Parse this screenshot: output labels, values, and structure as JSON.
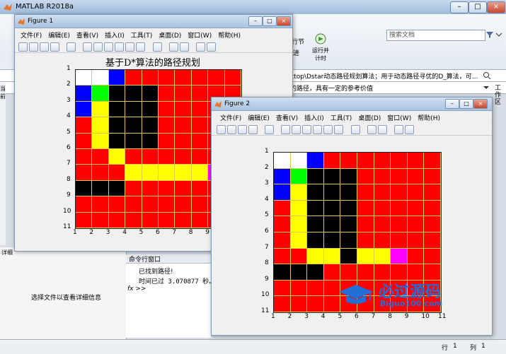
{
  "app": {
    "title": "MATLAB R2018a",
    "search_placeholder": "搜索文档",
    "ribbon": {
      "section_label": "行节",
      "run_label": "运行并\n计时",
      "sub_label": "进"
    },
    "path_text": "ktop\\Dstar动态路径规划算法；用于动态路径寻优的D_算法，可...",
    "desc_text": "的路径，具有一定的参考价值",
    "workspace_label": "工作区",
    "left_panel_text": "选择文件以查看详细信息",
    "left_panel_label": "详细",
    "current_folder_label": "当前",
    "command_window": {
      "title": "命令行窗口",
      "lines": [
        "已找到路径!",
        "时间已过 3.070877 秒。"
      ],
      "prompt": "fx >>"
    },
    "status": {
      "row_label": "行",
      "row": "1",
      "col_label": "列",
      "col": "1"
    },
    "watermark": {
      "main": "必过源码",
      "sub": "Biguo100.com"
    }
  },
  "figures": [
    {
      "title": "Figure 1",
      "plot_title": "基于D*算法的路径规划",
      "menu": [
        "文件(F)",
        "编辑(E)",
        "查看(V)",
        "插入(I)",
        "工具(T)",
        "桌面(D)",
        "窗口(W)",
        "帮助(H)"
      ],
      "x_ticks": [
        "1",
        "2",
        "3",
        "4",
        "5",
        "6",
        "7",
        "8",
        "9"
      ],
      "y_ticks": [
        "1",
        "2",
        "3",
        "4",
        "5",
        "6",
        "7",
        "8",
        "9",
        "10",
        "11"
      ]
    },
    {
      "title": "Figure 2",
      "plot_title": "",
      "menu": [
        "文件(F)",
        "编辑(E)",
        "查看(V)",
        "插入(I)",
        "工具(T)",
        "桌面(D)",
        "窗口(W)",
        "帮助(H)"
      ],
      "x_ticks": [
        "1",
        "2",
        "3",
        "4",
        "5",
        "6",
        "7",
        "8",
        "9",
        "10",
        "11"
      ],
      "y_ticks": [
        "1",
        "2",
        "3",
        "4",
        "5",
        "6",
        "7",
        "8",
        "9",
        "10",
        "11"
      ]
    }
  ],
  "colors": {
    "free": "#ff0000",
    "obstacle": "#000000",
    "path": "#ffff00",
    "start": "#ff00ff",
    "goal": "#ffffff",
    "visited_blue": "#0000ff",
    "visited_green": "#00ff00",
    "grid": "#e0c84a"
  },
  "chart_data": [
    {
      "type": "heatmap",
      "title": "基于D*算法的路径规划",
      "grid_size": [
        10,
        10
      ],
      "legend": {
        "R": "free",
        "K": "obstacle",
        "Y": "path",
        "M": "start",
        "W": "goal",
        "B": "visited_blue",
        "G": "visited_green"
      },
      "rows": [
        "WWBRRRRRRR",
        "BGKKKRRRRR",
        "BYKKKRRRRR",
        "RYKKKRRRRR",
        "RYKKKRRRRR",
        "RRYRRRRRRR",
        "RRRYYYYYMR",
        "KKKRRRRRRR",
        "RRRRRRRRRR",
        "RRRRRRRRRR"
      ]
    },
    {
      "type": "heatmap",
      "title": "",
      "grid_size": [
        10,
        10
      ],
      "legend": {
        "R": "free",
        "K": "obstacle",
        "Y": "path",
        "M": "start",
        "W": "goal",
        "B": "visited_blue",
        "G": "visited_green"
      },
      "rows": [
        "WWBRRRRRRR",
        "BGKKKRRRRR",
        "BYKKKRRRRR",
        "RYKKKRRRRR",
        "RYKKKRRRRR",
        "RYKKKRRRRR",
        "RRYYKYYMRR",
        "KKKRRRRRRR",
        "RRRRRRRRRR",
        "RRRRRRRRRR"
      ]
    }
  ]
}
